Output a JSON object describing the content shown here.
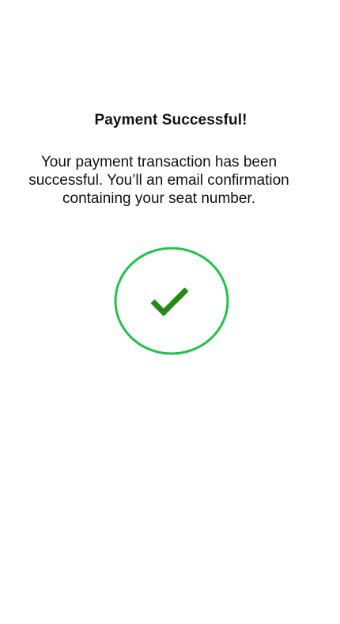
{
  "confirmation": {
    "title": "Payment Successful!",
    "message": "Your payment transaction has been successful. You’ll an email confirmation containing your seat number.",
    "icon": "check-circle-icon",
    "ring_color": "#22c24a",
    "check_color": "#238a12"
  }
}
